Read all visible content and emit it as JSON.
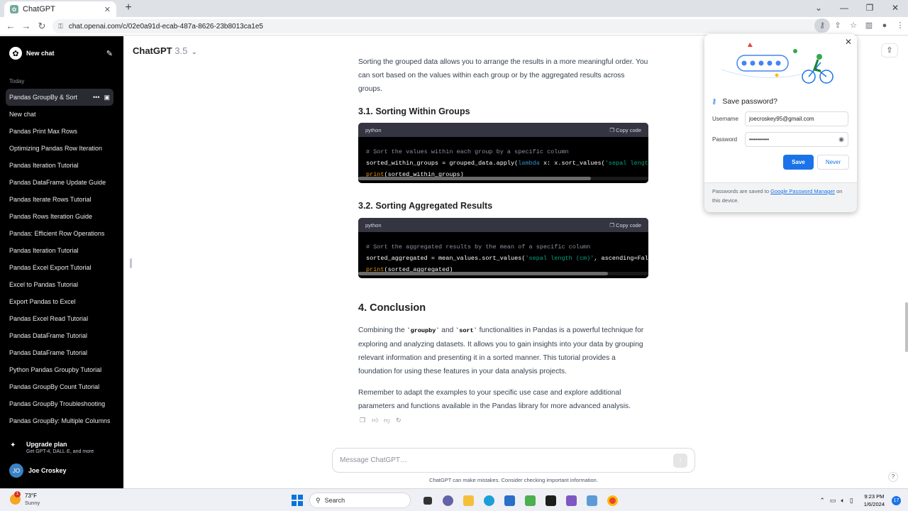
{
  "browser": {
    "tab_title": "ChatGPT",
    "url": "chat.openai.com/c/02e0a91d-ecab-487a-8626-23b8013ca1e5"
  },
  "sidebar": {
    "new_chat": "New chat",
    "section": "Today",
    "items": [
      {
        "label": "Pandas GroupBy & Sort"
      },
      {
        "label": "New chat"
      },
      {
        "label": "Pandas Print Max Rows"
      },
      {
        "label": "Optimizing Pandas Row Iteration"
      },
      {
        "label": "Pandas Iteration Tutorial"
      },
      {
        "label": "Pandas DataFrame Update Guide"
      },
      {
        "label": "Pandas Iterate Rows Tutorial"
      },
      {
        "label": "Pandas Rows Iteration Guide"
      },
      {
        "label": "Pandas: Efficient Row Operations"
      },
      {
        "label": "Pandas Iteration Tutorial"
      },
      {
        "label": "Pandas Excel Export Tutorial"
      },
      {
        "label": "Excel to Pandas Tutorial"
      },
      {
        "label": "Export Pandas to Excel"
      },
      {
        "label": "Pandas Excel Read Tutorial"
      },
      {
        "label": "Pandas DataFrame Tutorial"
      },
      {
        "label": "Pandas DataFrame Tutorial"
      },
      {
        "label": "Python Pandas Groupby Tutorial"
      },
      {
        "label": "Pandas GroupBy Count Tutorial"
      },
      {
        "label": "Pandas GroupBy Troubleshooting"
      },
      {
        "label": "Pandas GroupBy: Multiple Columns"
      }
    ],
    "upgrade_title": "Upgrade plan",
    "upgrade_sub": "Get GPT-4, DALL·E, and more",
    "user_initials": "JO",
    "user_name": "Joe Croskey"
  },
  "main": {
    "model_name": "ChatGPT",
    "model_version": "3.5",
    "intro_text": "Sorting the grouped data allows you to arrange the results in a more meaningful order. You can sort based on the values within each group or by the aggregated results across groups.",
    "h_31": "3.1. Sorting Within Groups",
    "code1": {
      "lang": "python",
      "copy": "Copy code",
      "comment": "# Sort the values within each group by a specific column",
      "l2a": "sorted_within_groups = grouped_data.apply(",
      "l2kw": "lambda",
      "l2b": " x: x.sort_values(",
      "l2str": "'sepal length (cm)'",
      "l3fn": "print",
      "l3b": "(sorted_within_groups)"
    },
    "h_32": "3.2. Sorting Aggregated Results",
    "code2": {
      "lang": "python",
      "copy": "Copy code",
      "comment": "# Sort the aggregated results by the mean of a specific column",
      "l2a": "sorted_aggregated = mean_values.sort_values(",
      "l2str": "'sepal length (cm)'",
      "l2b": ", ascending=False)",
      "l3fn": "print",
      "l3b": "(sorted_aggregated)"
    },
    "h_4": "4. Conclusion",
    "concl_1a": "Combining the ",
    "concl_code1": "`groupby`",
    "concl_1b": " and ",
    "concl_code2": "`sort`",
    "concl_1c": " functionalities in Pandas is a powerful technique for exploring and analyzing datasets. It allows you to gain insights into your data by grouping relevant information and presenting it in a sorted manner. This tutorial provides a foundation for using these features in your data analysis projects.",
    "concl_2": "Remember to adapt the examples to your specific use case and explore additional parameters and functions available in the Pandas library for more advanced analysis.",
    "composer_placeholder": "Message ChatGPT…",
    "disclaimer": "ChatGPT can make mistakes. Consider checking important information.",
    "help": "?"
  },
  "password_popup": {
    "title": "Save password?",
    "username_label": "Username",
    "username_value": "joecroskey95@gmail.com",
    "password_label": "Password",
    "password_value": "••••••••••",
    "save": "Save",
    "never": "Never",
    "footer_a": "Passwords are saved to ",
    "footer_link": "Google Password Manager",
    "footer_b": " on this device."
  },
  "taskbar": {
    "temp": "73°F",
    "weather": "Sunny",
    "weather_badge": "1",
    "search": "Search",
    "time": "9:23 PM",
    "date": "1/6/2024",
    "notifications": "17"
  },
  "colors": {
    "sidebar_bg": "#000000",
    "accent": "#1a73e8",
    "code_bg": "#000000"
  }
}
